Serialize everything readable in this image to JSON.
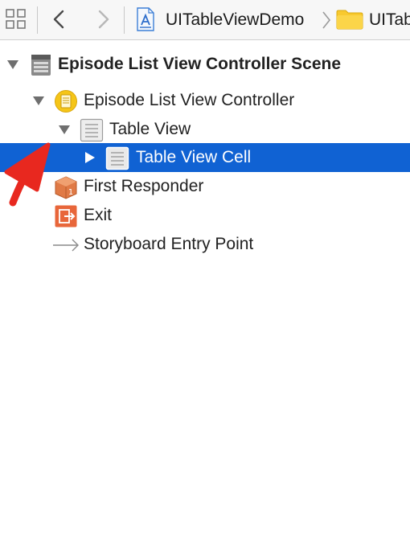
{
  "toolbar": {
    "breadcrumb": {
      "project": "UITableViewDemo",
      "folder": "UITab"
    }
  },
  "outline": {
    "rows": [
      {
        "label": "Episode List View Controller Scene",
        "icon": "scene-icon",
        "expanded": true
      },
      {
        "label": "Episode List View Controller",
        "icon": "view-controller-icon",
        "expanded": true
      },
      {
        "label": "Table View",
        "icon": "table-view-icon",
        "expanded": true
      },
      {
        "label": "Table View Cell",
        "icon": "table-view-cell-icon",
        "expanded": false,
        "selected": true
      },
      {
        "label": "First Responder",
        "icon": "first-responder-icon"
      },
      {
        "label": "Exit",
        "icon": "exit-icon"
      },
      {
        "label": "Storyboard Entry Point",
        "icon": "entry-point-arrow-icon"
      }
    ]
  },
  "colors": {
    "selection": "#1062d3",
    "annotation_arrow": "#e8281f",
    "view_controller_icon": "#f5c518",
    "first_responder_icon": "#e07a46",
    "exit_icon": "#e8663a",
    "folder_icon": "#f8c92f"
  }
}
